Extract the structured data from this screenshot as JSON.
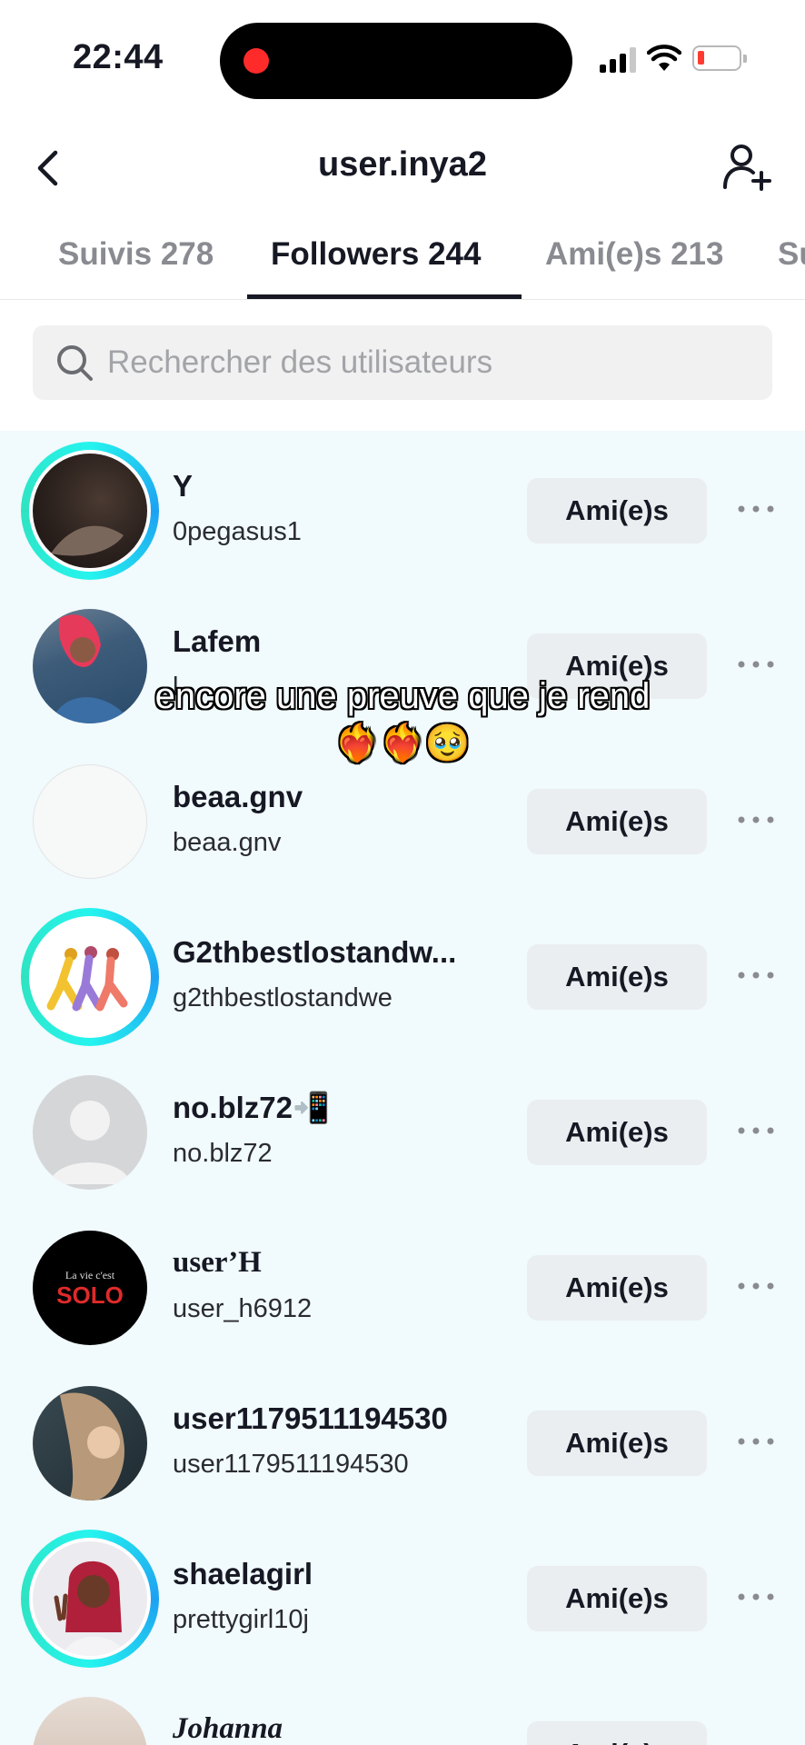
{
  "status_bar": {
    "time": "22:44"
  },
  "header": {
    "title": "user.inya2"
  },
  "tabs": [
    {
      "label": "Suivis 278",
      "active": false
    },
    {
      "label": "Followers 244",
      "active": true
    },
    {
      "label": "Ami(e)s 213",
      "active": false
    },
    {
      "label": "Su",
      "active": false
    }
  ],
  "search": {
    "placeholder": "Rechercher des utilisateurs",
    "value": ""
  },
  "users": [
    {
      "name": "Y",
      "handle": "0pegasus1",
      "button": "Ami(e)s",
      "story_ring": true
    },
    {
      "name": "Lafem",
      "handle": "l",
      "button": "Ami(e)s",
      "story_ring": false
    },
    {
      "name": "beaa.gnv",
      "handle": "beaa.gnv",
      "button": "Ami(e)s",
      "story_ring": false
    },
    {
      "name": "G2thbestlostandw...",
      "handle": "g2thbestlostandwe",
      "button": "Ami(e)s",
      "story_ring": true
    },
    {
      "name": "no.blz72📲",
      "handle": "no.blz72",
      "button": "Ami(e)s",
      "story_ring": false
    },
    {
      "name": "user’H",
      "handle": "user_h6912",
      "button": "Ami(e)s",
      "story_ring": false,
      "avatar_text": "La vie c'est SOLO"
    },
    {
      "name": "user1179511194530",
      "handle": "user1179511194530",
      "button": "Ami(e)s",
      "story_ring": false
    },
    {
      "name": "shaelagirl",
      "handle": "prettygirl10j",
      "button": "Ami(e)s",
      "story_ring": true
    },
    {
      "name": "Johanna",
      "handle": "",
      "button": "Ami(e)s",
      "story_ring": false
    }
  ],
  "overlay": {
    "caption": "encore une preuve que je rend ❤️‍🔥❤️‍🔥🥹"
  },
  "colors": {
    "accent_ring": "#25f4ee",
    "record": "#ff2a2a",
    "battery_low": "#ff3b30"
  }
}
